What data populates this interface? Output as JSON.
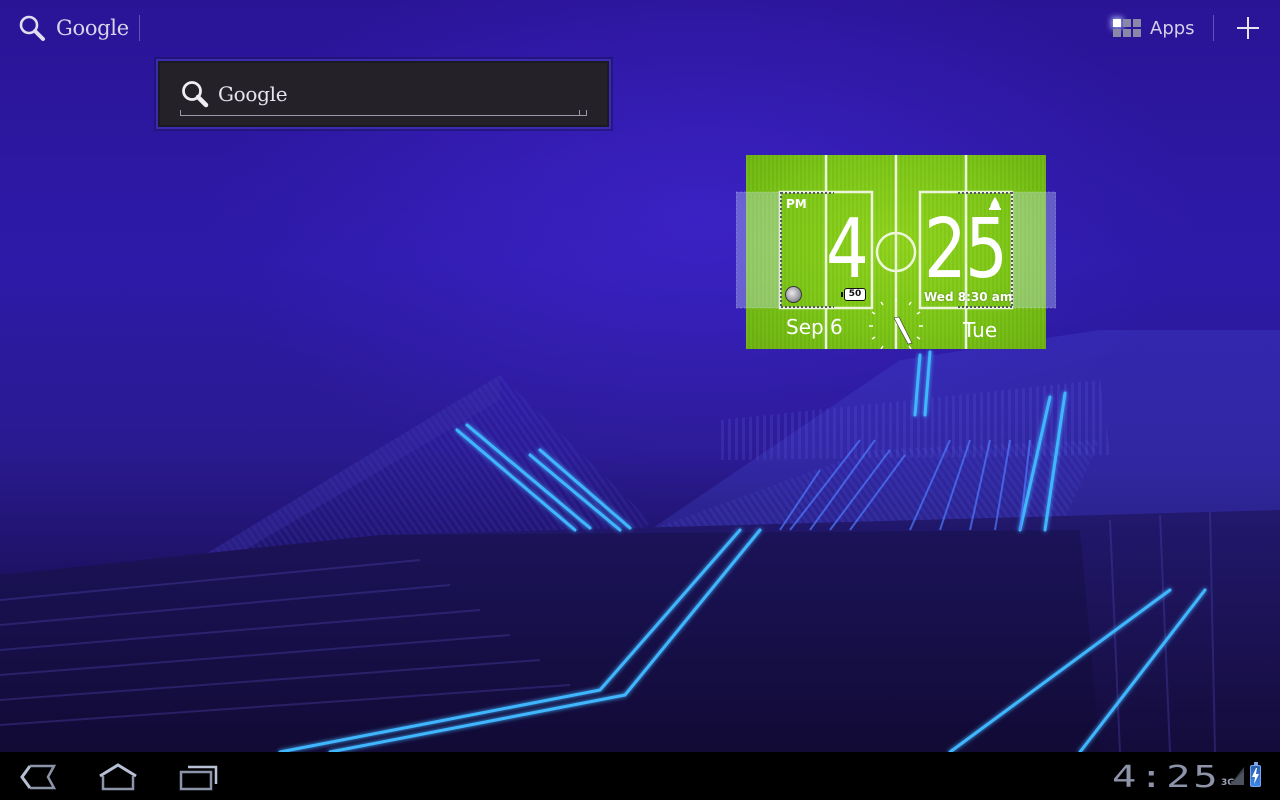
{
  "top_bar": {
    "search_label": "Google",
    "search_icon": "search-icon",
    "apps_label": "Apps",
    "apps_icon": "apps-grid-icon",
    "add_icon": "plus-icon"
  },
  "search_widget": {
    "label": "Google",
    "icon": "search-icon"
  },
  "clock_widget": {
    "ampm": "PM",
    "hour": "4",
    "minute": "25",
    "date": "Sep 6",
    "weekday": "Tue",
    "next_alarm": "Wed 8:30 am",
    "battery_level": "50",
    "theme_colors": {
      "grass": "#7cc615",
      "lines": "#ffffff"
    }
  },
  "system_bar": {
    "back_icon": "back-icon",
    "home_icon": "home-icon",
    "recent_apps_icon": "recent-apps-icon",
    "time": "4:25",
    "network": "3G",
    "signal_icon": "signal-icon",
    "battery_icon": "battery-charging-icon"
  },
  "colors": {
    "wallpaper_primary": "#2d1aa8",
    "wallpaper_accent": "#3fb6ff",
    "system_bar": "#000000",
    "clock_digits": "#8d93a8"
  }
}
